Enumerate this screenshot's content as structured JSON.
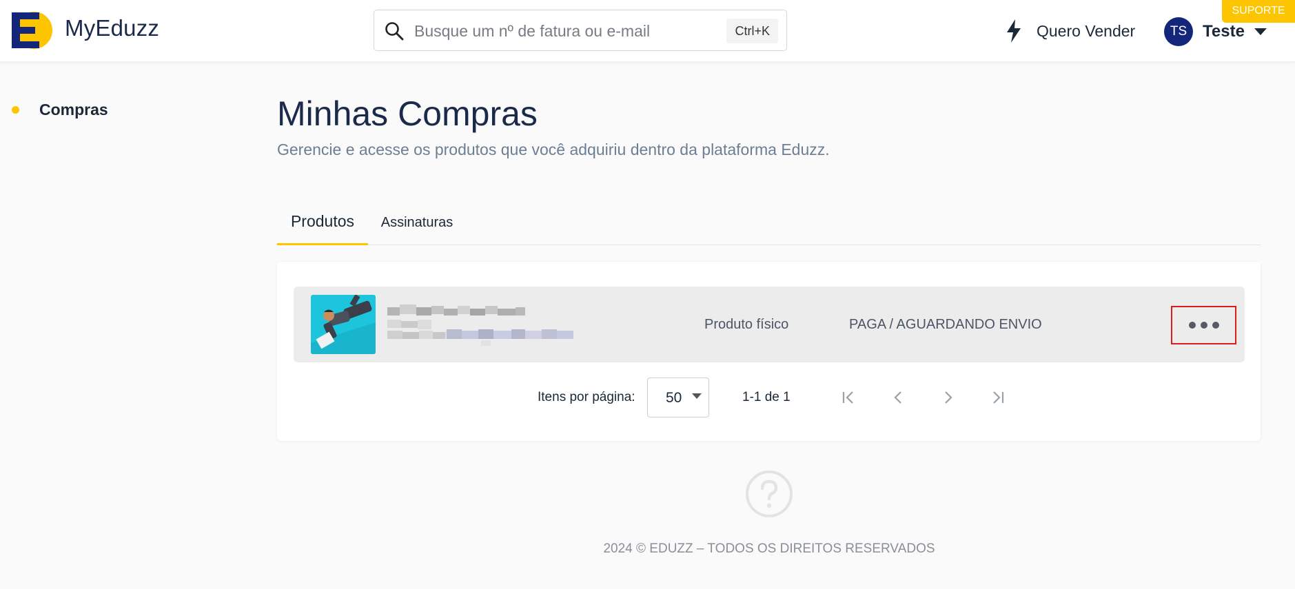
{
  "header": {
    "brand": "MyEduzz",
    "search": {
      "placeholder": "Busque um nº de fatura ou e-mail",
      "value": "",
      "shortcut": "Ctrl+K"
    },
    "sell_label": "Quero Vender",
    "user": {
      "initials": "TS",
      "name": "Teste"
    },
    "support_label": "SUPORTE"
  },
  "sidebar": {
    "items": [
      {
        "label": "Compras",
        "active": true
      }
    ]
  },
  "main": {
    "title": "Minhas Compras",
    "subtitle": "Gerencie e acesse os produtos que você adquiriu dentro da plataforma Eduzz.",
    "tabs": [
      {
        "label": "Produtos",
        "active": true
      },
      {
        "label": "Assinaturas",
        "active": false
      }
    ],
    "products": [
      {
        "type": "Produto físico",
        "status": "PAGA / AGUARDANDO ENVIO"
      }
    ],
    "pagination": {
      "items_per_page_label": "Itens por página:",
      "items_per_page": "50",
      "range": "1-1 de 1"
    }
  },
  "footer": {
    "text": "2024 © EDUZZ – TODOS OS DIREITOS RESERVADOS"
  },
  "colors": {
    "accent": "#fdc500",
    "brand_navy": "#14267a",
    "highlight_border": "#e01b1b"
  },
  "icons": [
    "eduzz-logo-icon",
    "search-icon",
    "bolt-icon",
    "chevron-down-icon",
    "more-horizontal-icon",
    "first-page-icon",
    "prev-page-icon",
    "next-page-icon",
    "last-page-icon",
    "help-icon"
  ]
}
